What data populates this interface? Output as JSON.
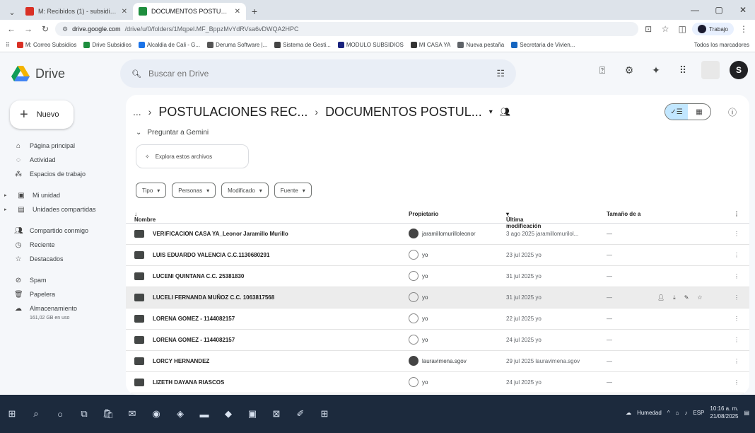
{
  "browser": {
    "tabs": [
      {
        "label": "M: Recibidos (1) - subsidioscasa...",
        "active": false
      },
      {
        "label": "DOCUMENTOS POSTULACION",
        "active": true
      }
    ],
    "url_domain": "drive.google.com",
    "url_path": "/drive/u/0/folders/1Mqpel.MF_BppzMvYdRVsa6vDWQA2HPC",
    "profile_label": "Trabajo",
    "bookmarks": [
      {
        "label": "M: Correo Subsidios",
        "color": "#d93025"
      },
      {
        "label": "Drive Subsidios",
        "color": "#1e8e3e"
      },
      {
        "label": "Alcaldia de Cali - G...",
        "color": "#1a73e8"
      },
      {
        "label": "Deruma Software |...",
        "color": "#555555"
      },
      {
        "label": "Sistema de Gesti...",
        "color": "#444444"
      },
      {
        "label": "MODULO SUBSIDIOS",
        "color": "#1a237e"
      },
      {
        "label": "MI CASA YA",
        "color": "#333333"
      },
      {
        "label": "Nueva pestaña",
        "color": "#5f6368"
      },
      {
        "label": "Secretaria de Vivien...",
        "color": "#1565c0"
      }
    ],
    "other_bookmarks": "Todos los marcadores"
  },
  "drive": {
    "app_name": "Drive",
    "search_placeholder": "Buscar en Drive",
    "user_initial": "S"
  },
  "sidebar": {
    "new_label": "Nuevo",
    "items": [
      {
        "label": "Página principal",
        "icon": "home-icon"
      },
      {
        "label": "Actividad",
        "icon": "activity-icon"
      },
      {
        "label": "Espacios de trabajo",
        "icon": "workspaces-icon"
      },
      {
        "label": "Mi unidad",
        "icon": "my-drive-icon"
      },
      {
        "label": "Unidades compartidas",
        "icon": "shared-drives-icon"
      },
      {
        "label": "Compartido conmigo",
        "icon": "shared-with-me-icon"
      },
      {
        "label": "Reciente",
        "icon": "recent-icon"
      },
      {
        "label": "Destacados",
        "icon": "star-icon"
      },
      {
        "label": "Spam",
        "icon": "spam-icon"
      },
      {
        "label": "Papelera",
        "icon": "trash-icon"
      },
      {
        "label": "Almacenamiento",
        "icon": "cloud-icon"
      }
    ],
    "storage_text": "161,02 GB en uso"
  },
  "main": {
    "breadcrumb_ellipsis": "...",
    "breadcrumb_parent": "POSTULACIONES REC...",
    "breadcrumb_current": "DOCUMENTOS POSTUL...",
    "gemini_label": "Preguntar a Gemini",
    "explore_label": "Explora estos archivos",
    "filters": [
      "Tipo",
      "Personas",
      "Modificado",
      "Fuente"
    ],
    "columns": {
      "name": "Nombre",
      "owner": "Propietario",
      "modified": "Última modificación",
      "size": "Tamaño de a"
    },
    "rows": [
      {
        "name": "VERIFICACION CASA YA_Leonor Jaramillo Murillo",
        "owner": "jaramillomurilloleonor",
        "owner_avatar": "img",
        "date": "3 ago 2025 jaramillomurilol...",
        "size": "—"
      },
      {
        "name": "LUIS EDUARDO VALENCIA C.C.1130680291",
        "owner": "yo",
        "owner_avatar": "outline",
        "date": "23 jul 2025 yo",
        "size": "—"
      },
      {
        "name": "LUCENI QUINTANA C.C. 25381830",
        "owner": "yo",
        "owner_avatar": "outline",
        "date": "31 jul 2025 yo",
        "size": "—"
      },
      {
        "name": "LUCELI FERNANDA MUÑOZ C.C. 1063817568",
        "owner": "yo",
        "owner_avatar": "outline",
        "date": "31 jul 2025 yo",
        "size": "—"
      },
      {
        "name": "LORENA GOMEZ - 1144082157",
        "owner": "yo",
        "owner_avatar": "outline",
        "date": "22 jul 2025 yo",
        "size": "—"
      },
      {
        "name": "LORENA GOMEZ - 1144082157",
        "owner": "yo",
        "owner_avatar": "outline",
        "date": "24 jul 2025 yo",
        "size": "—"
      },
      {
        "name": "LORCY HERNANDEZ",
        "owner": "lauravimena.sgov",
        "owner_avatar": "img",
        "date": "29 jul 2025 lauravimena.sgov",
        "size": "—"
      },
      {
        "name": "LIZETH DAYANA RIASCOS",
        "owner": "yo",
        "owner_avatar": "outline",
        "date": "24 jul 2025 yo",
        "size": "—"
      }
    ],
    "hover_row_index": 3
  },
  "taskbar": {
    "weather": "Humedad",
    "lang": "ESP",
    "time": "10:16 a. m.",
    "date": "21/08/2025"
  }
}
